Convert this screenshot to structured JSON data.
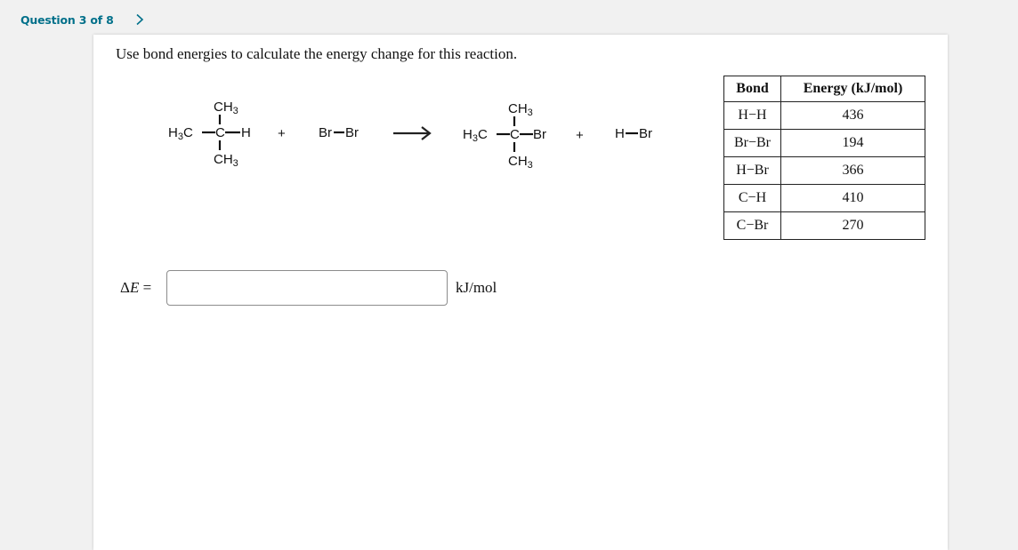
{
  "header": {
    "question_label": "Question 3 of 8",
    "next_icon": "chevron-right-icon",
    "accent_color": "#00708a"
  },
  "question": {
    "prompt": "Use bond energies to calculate the energy change for this reaction.",
    "reaction": {
      "reactant1": {
        "top": "CH3",
        "left": "H3C",
        "center": "C",
        "right": "H",
        "bottom": "CH3"
      },
      "plus1": "+",
      "reactant2": "Br—Br",
      "arrow_icon": "reaction-arrow-icon",
      "product1": {
        "top": "CH3",
        "left": "H3C",
        "center": "C",
        "right": "Br",
        "bottom": "CH3"
      },
      "plus2": "+",
      "product2": "H—Br"
    },
    "bond_table": {
      "headers": [
        "Bond",
        "Energy (kJ/mol)"
      ],
      "rows": [
        {
          "bond": "H−H",
          "energy": "436"
        },
        {
          "bond": "Br−Br",
          "energy": "194"
        },
        {
          "bond": "H−Br",
          "energy": "366"
        },
        {
          "bond": "C−H",
          "energy": "410"
        },
        {
          "bond": "C−Br",
          "energy": "270"
        }
      ]
    },
    "answer": {
      "label_delta": "Δ",
      "label_var": "E",
      "label_eq": " =",
      "value": "",
      "placeholder": "",
      "unit": "kJ/mol"
    }
  }
}
